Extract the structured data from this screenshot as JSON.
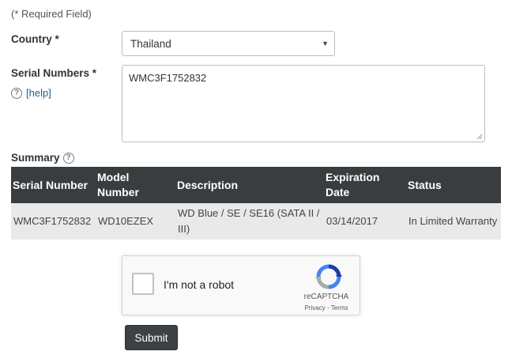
{
  "form": {
    "required_note": "(* Required Field)",
    "country_label": "Country *",
    "country_value": "Thailand",
    "serial_label": "Serial Numbers *",
    "help_link": "[help]",
    "serial_value": "WMC3F1752832"
  },
  "summary": {
    "title": "Summary",
    "columns": [
      "Serial Number",
      "Model Number",
      "Description",
      "Expiration Date",
      "Status"
    ],
    "rows": [
      {
        "serial": "WMC3F1752832",
        "model": "WD10EZEX",
        "description": "WD Blue / SE / SE16 (SATA II / III)",
        "expiration": "03/14/2017",
        "status": "In Limited Warranty"
      }
    ]
  },
  "captcha": {
    "label": "I'm not a robot",
    "brand": "reCAPTCHA",
    "links": "Privacy - Terms"
  },
  "submit_label": "Submit",
  "icons": [
    "question-circle-icon",
    "select-caret-icon",
    "resize-grip-icon",
    "recaptcha-logo-icon"
  ],
  "colors": {
    "table_header_bg": "#3a3d40",
    "table_row_bg": "#e9e9e9",
    "link": "#1f5f8b",
    "submit_bg": "#3e4144"
  }
}
